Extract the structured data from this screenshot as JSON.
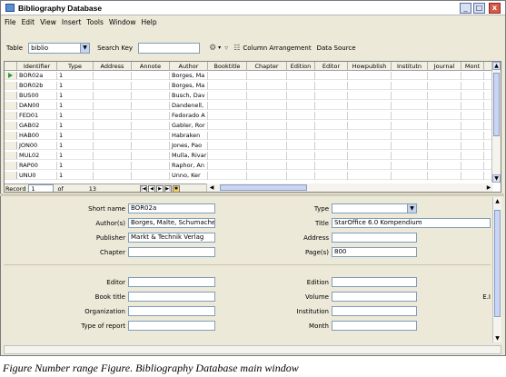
{
  "window": {
    "title": "Bibliography Database"
  },
  "window_controls": {
    "minimize": "_",
    "maximize": "□",
    "close": "x"
  },
  "menu": [
    "File",
    "Edit",
    "View",
    "Insert",
    "Tools",
    "Window",
    "Help"
  ],
  "toolbar": {
    "table_label": "Table",
    "table_value": "biblio",
    "search_key_label": "Search Key",
    "search_key_value": "",
    "column_arrangement": "Column Arrangement",
    "data_source": "Data Source"
  },
  "grid": {
    "columns": [
      "Identifier",
      "Type",
      "Address",
      "Annote",
      "Author",
      "Booktitle",
      "Chapter",
      "Edition",
      "Editor",
      "Howpublish",
      "Institutn",
      "Journal",
      "Mont"
    ],
    "rows": [
      {
        "identifier": "BOR02a",
        "type": "1",
        "author": "Borges, Ma"
      },
      {
        "identifier": "BOR02b",
        "type": "1",
        "author": "Borges, Ma"
      },
      {
        "identifier": "BUS00",
        "type": "1",
        "author": "Busch, Dav"
      },
      {
        "identifier": "DAN00",
        "type": "1",
        "author": "Dandenell,"
      },
      {
        "identifier": "FED01",
        "type": "1",
        "author": "Fedorado A"
      },
      {
        "identifier": "GAB02",
        "type": "1",
        "author": "Gabler, Ror"
      },
      {
        "identifier": "HAB00",
        "type": "1",
        "author": "Habraken"
      },
      {
        "identifier": "JON00",
        "type": "1",
        "author": "Jones, Pao"
      },
      {
        "identifier": "MUL02",
        "type": "1",
        "author": "Mulla, Rivar"
      },
      {
        "identifier": "RAP00",
        "type": "1",
        "author": "Raphor, An"
      },
      {
        "identifier": "UNU0",
        "type": "1",
        "author": "Unno, Ker"
      }
    ],
    "navigator": {
      "record_label": "Record",
      "record_value": "1",
      "of_label": "of",
      "total": "13"
    }
  },
  "form": {
    "short_name": {
      "label": "Short name",
      "value": "BOR02a"
    },
    "type": {
      "label": "Type",
      "value": ""
    },
    "authors": {
      "label": "Author(s)",
      "value": "Borges, Malte, Schumacher,"
    },
    "title": {
      "label": "Title",
      "value": "StarOffice 6.0 Kompendium"
    },
    "publisher": {
      "label": "Publisher",
      "value": "Markt & Technik Verlag"
    },
    "address": {
      "label": "Address",
      "value": ""
    },
    "chapter": {
      "label": "Chapter",
      "value": ""
    },
    "pages": {
      "label": "Page(s)",
      "value": "800"
    },
    "editor": {
      "label": "Editor",
      "value": ""
    },
    "edition": {
      "label": "Edition",
      "value": ""
    },
    "book_title": {
      "label": "Book title",
      "value": ""
    },
    "volume": {
      "label": "Volume",
      "value": ""
    },
    "organization": {
      "label": "Organization",
      "value": ""
    },
    "institution": {
      "label": "Institution",
      "value": ""
    },
    "type_of_report": {
      "label": "Type of report",
      "value": ""
    },
    "month": {
      "label": "Month",
      "value": ""
    },
    "side_marker": "E.I"
  },
  "caption": "Figure Number range Figure. Bibliography Database main window",
  "colors": {
    "record_pointer": "#2a9d3a",
    "window_bg": "#ece9d8"
  },
  "icons": [
    "app-icon",
    "row-pointer-icon",
    "filter-icon",
    "column-arrangement-icon"
  ]
}
